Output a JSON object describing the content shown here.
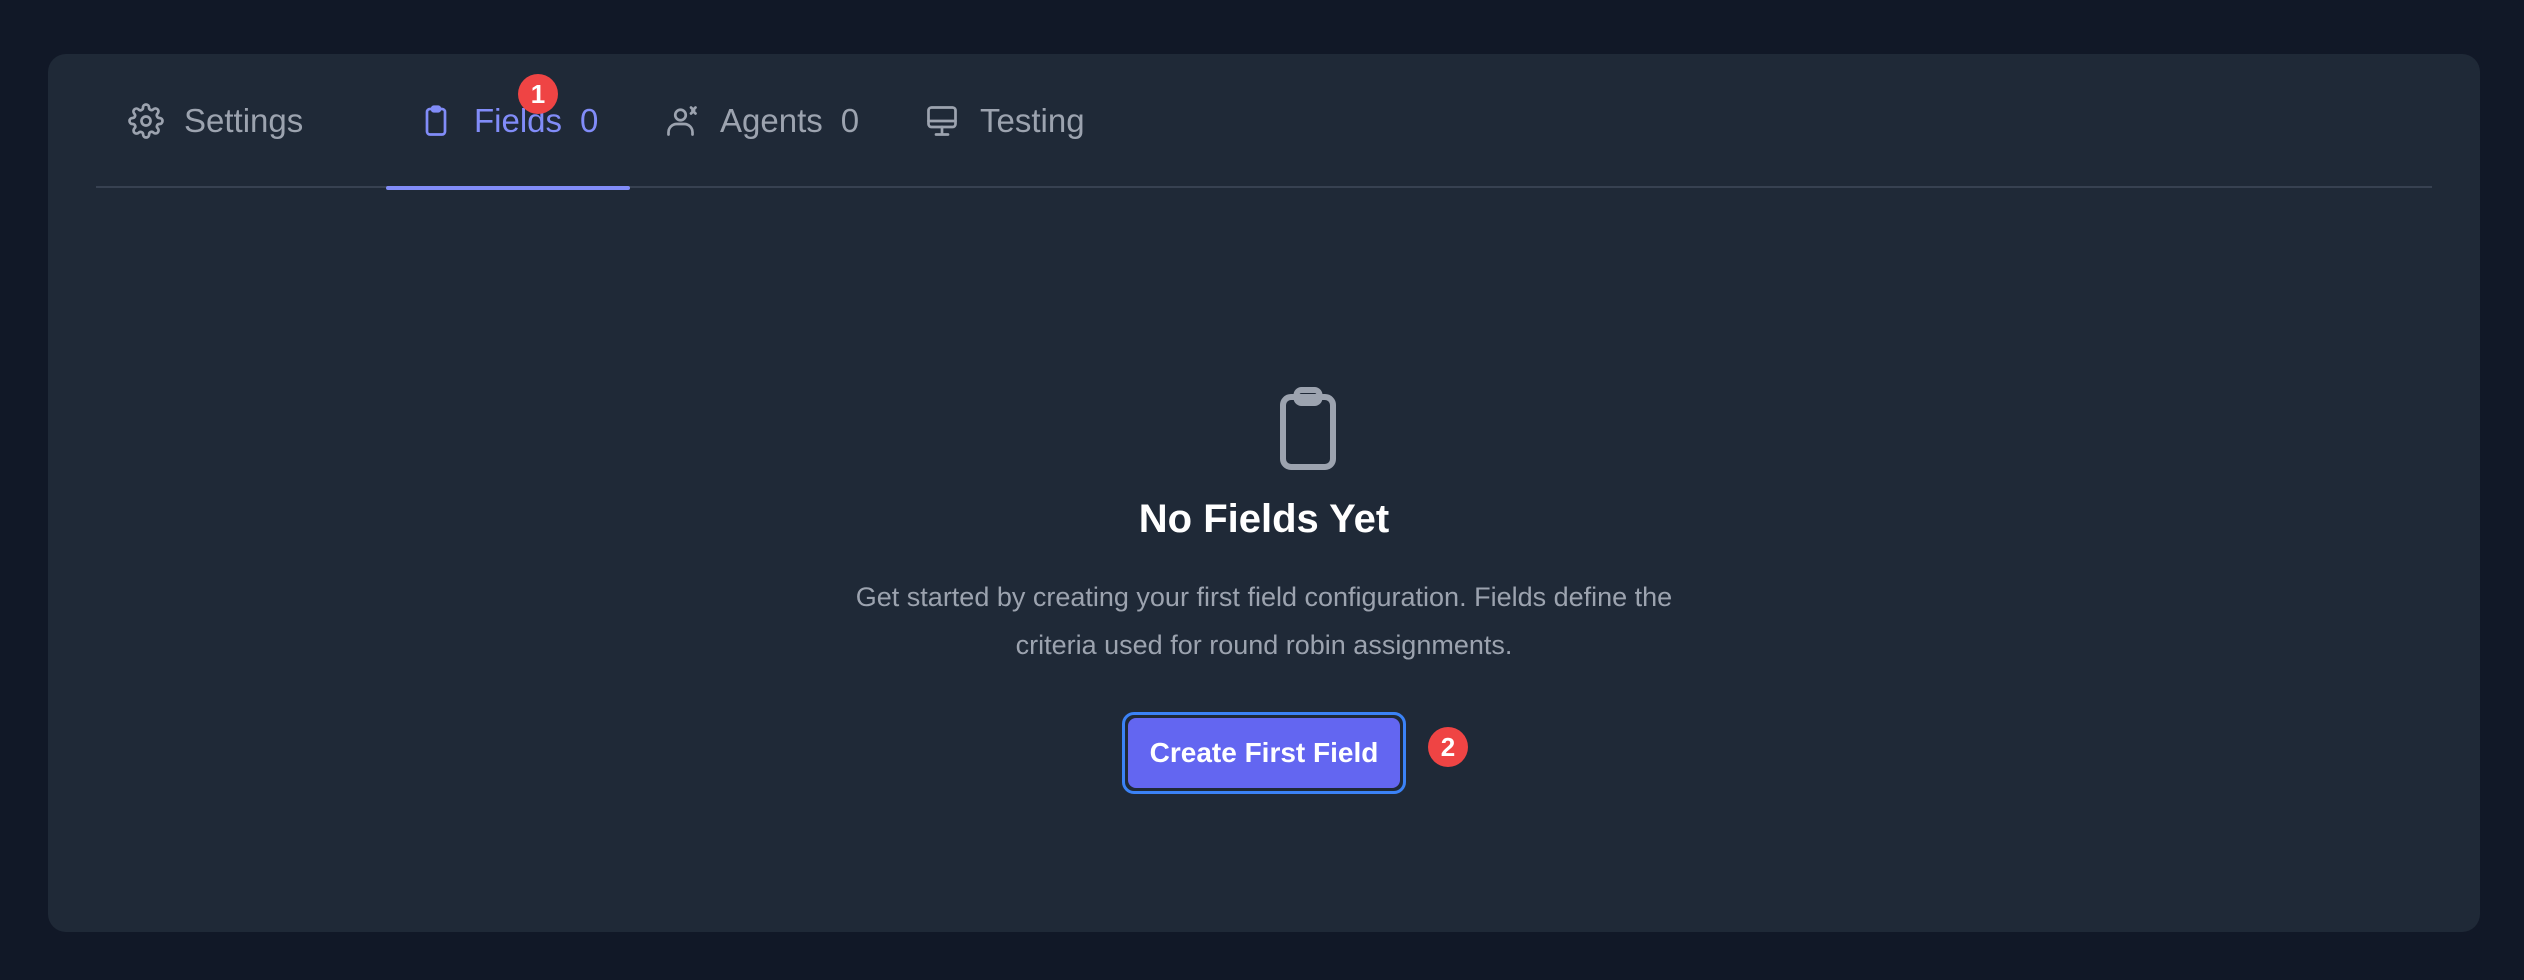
{
  "tabs": {
    "settings": {
      "label": "Settings",
      "icon": "gear-icon"
    },
    "fields": {
      "label": "Fields",
      "count": "0",
      "icon": "clipboard-icon"
    },
    "agents": {
      "label": "Agents",
      "count": "0",
      "icon": "user-assign-icon"
    },
    "testing": {
      "label": "Testing",
      "icon": "monitor-icon"
    }
  },
  "annotations": {
    "tab_marker": "1",
    "button_marker": "2"
  },
  "empty_state": {
    "icon": "clipboard-icon",
    "title": "No Fields Yet",
    "description": "Get started by creating your first field configuration. Fields define the criteria used for round robin assignments.",
    "button_label": "Create First Field"
  },
  "colors": {
    "background": "#111827",
    "card": "#1f2937",
    "accent": "#818cf8",
    "button": "#6366f1",
    "badge": "#ef4444",
    "muted_text": "#9ca3af"
  }
}
